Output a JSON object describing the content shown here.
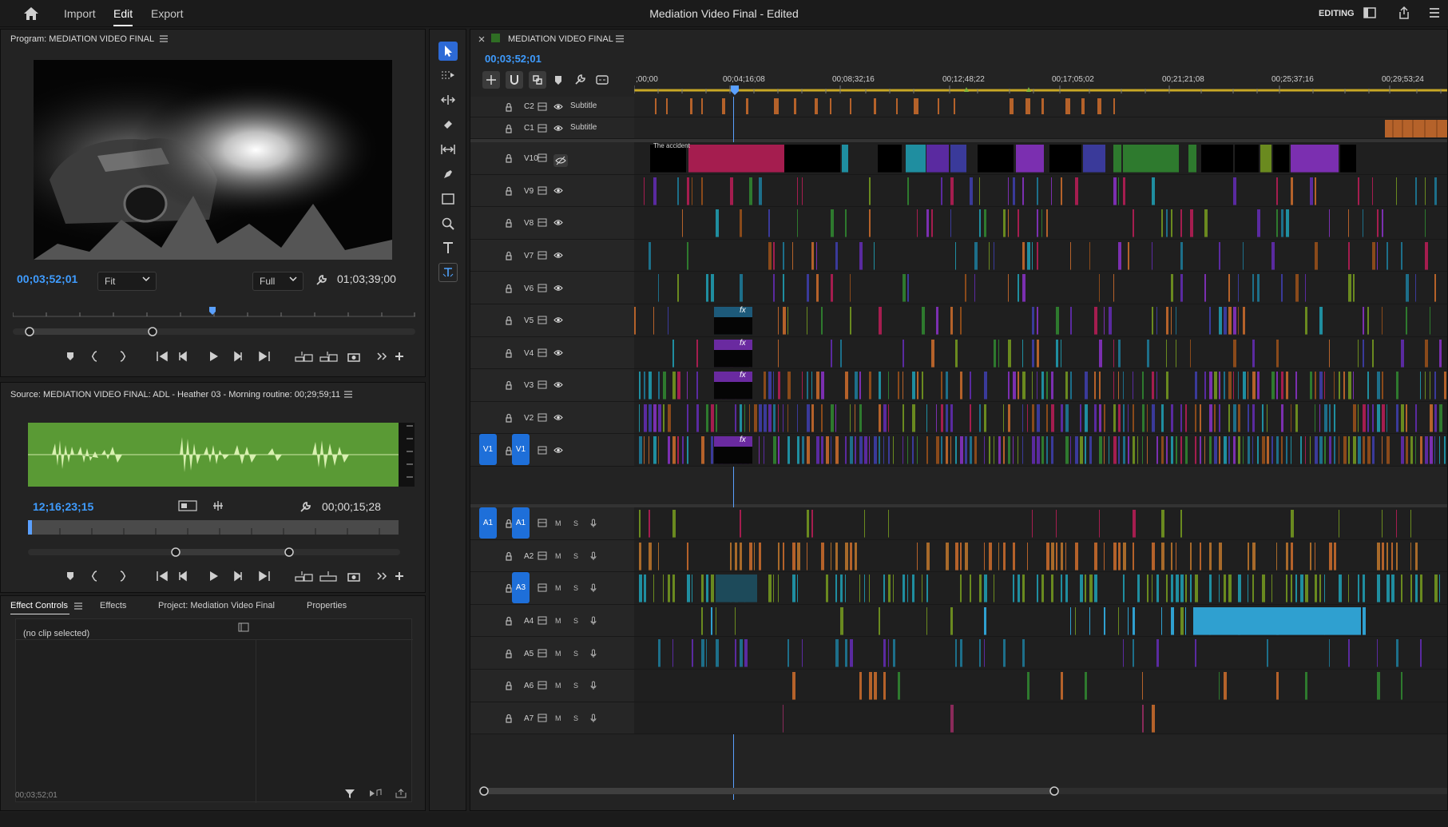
{
  "app": {
    "nav_items": [
      "Import",
      "Edit",
      "Export"
    ],
    "active_nav": "Edit",
    "document_title": "Mediation Video Final - Edited",
    "workspace_label": "EDITING"
  },
  "program_monitor": {
    "title": "Program: MEDIATION VIDEO FINAL",
    "timecode": "00;03;52;01",
    "fit_label": "Fit",
    "quality_label": "Full",
    "duration": "01;03;39;00"
  },
  "source_monitor": {
    "title": "Source: MEDIATION VIDEO FINAL: ADL - Heather 03 - Morning routine: 00;29;59;11",
    "timecode": "12;16;23;15",
    "duration": "00;00;15;28"
  },
  "effects_panel": {
    "tabs": [
      "Effect Controls",
      "Effects",
      "Project: Mediation Video Final",
      "Properties"
    ],
    "active_tab": "Effect Controls",
    "empty_message": "(no clip selected)",
    "footer_timecode": "00;03;52;01"
  },
  "timeline": {
    "title": "MEDIATION VIDEO FINAL",
    "timecode": "00;03;52;01",
    "ruler_labels": [
      ";00;00",
      "00;04;16;08",
      "00;08;32;16",
      "00;12;48;22",
      "00;17;05;02",
      "00;21;21;08",
      "00;25;37;16",
      "00;29;53;24"
    ],
    "caption_tracks": [
      {
        "name": "C2",
        "label": "Subtitle"
      },
      {
        "name": "C1",
        "label": "Subtitle"
      }
    ],
    "video_tracks": [
      "V10",
      "V9",
      "V8",
      "V7",
      "V6",
      "V5",
      "V4",
      "V3",
      "V2",
      "V1"
    ],
    "audio_tracks": [
      "A1",
      "A2",
      "A3",
      "A4",
      "A5",
      "A6",
      "A7"
    ],
    "source_patch_labels": {
      "video": "V1",
      "audio": "A1"
    },
    "mute_label": "M",
    "solo_label": "S",
    "fx_label": "fx",
    "clip_title_text": "The accident"
  },
  "colors": {
    "accent_blue": "#2d6ad6",
    "timecode_blue": "#3f9cff",
    "playhead": "#5aa0ff",
    "waveform_green": "#5a9a35"
  }
}
